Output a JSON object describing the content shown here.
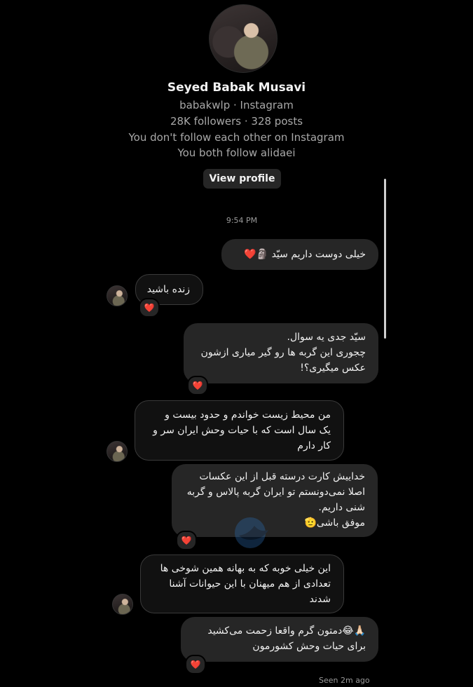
{
  "profile": {
    "name": "Seyed Babak Musavi",
    "handle_line": "babakwlp · Instagram",
    "stats": "28K followers · 328 posts",
    "follow_status": "You don't follow each other on Instagram",
    "mutual": "You both follow alidaei",
    "view_profile_label": "View profile"
  },
  "conversation": {
    "timestamp": "9:54 PM",
    "messages": [
      {
        "from": "me",
        "lines": [
          "خیلی دوست داریم سیّد 🗿❤️"
        ]
      },
      {
        "from": "them",
        "lines": [
          "زنده باشید"
        ],
        "reaction": "❤️"
      },
      {
        "from": "me",
        "lines": [
          "سیّد جدی یه سوال.",
          "چجوری این گربه ها رو گیر میاری ازشون",
          "عکس میگیری؟!"
        ],
        "reaction": "❤️"
      },
      {
        "from": "them",
        "lines": [
          "من محیط زیست خواندم و حدود بیست و",
          "یک سال است که با حیات وحش ایران سر و",
          "کار دارم"
        ]
      },
      {
        "from": "me",
        "lines": [
          "خداییش کارت درسته قبل از این عکسات",
          "اصلا نمی‌دونستم تو ایران گربه پالاس و گربه",
          "شنی داریم.",
          "موفق باشی🫡"
        ],
        "reaction": "❤️"
      },
      {
        "from": "them",
        "lines": [
          "این خیلی خوبه که به بهانه همین شوخی ها",
          "تعدادی از هم میهنان با این حیوانات آشنا",
          "شدند"
        ]
      },
      {
        "from": "me",
        "lines": [
          "🙏🏻😂دمتون گرم واقعا زحمت می‌کشید",
          "برای حیات وحش کشورمون"
        ],
        "reaction": "❤️"
      }
    ],
    "seen": "Seen 2m ago"
  },
  "colors": {
    "background": "#000000",
    "bubble": "#262626",
    "reaction": "#ff3040"
  }
}
